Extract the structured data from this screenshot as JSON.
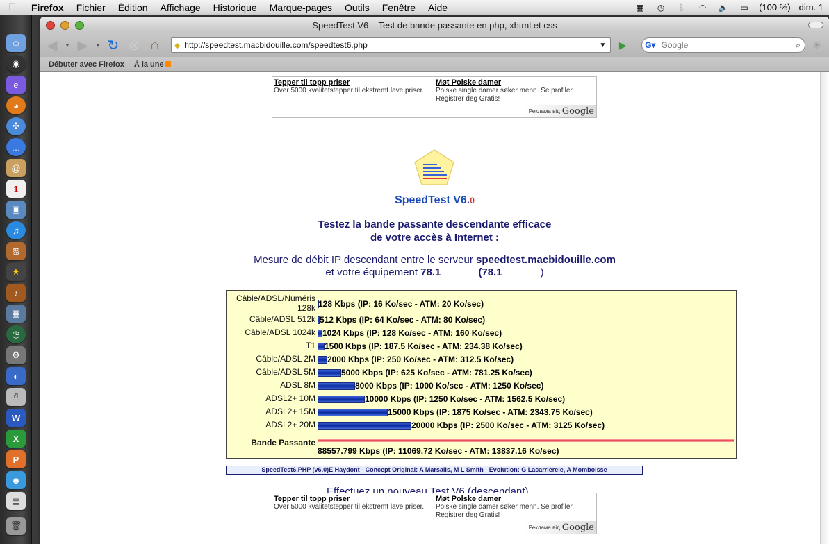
{
  "menubar": {
    "app_name": "Firefox",
    "items": [
      "Fichier",
      "Édition",
      "Affichage",
      "Historique",
      "Marque-pages",
      "Outils",
      "Fenêtre",
      "Aide"
    ],
    "battery": "(100 %)",
    "clock": "dim. 1"
  },
  "window": {
    "title": "SpeedTest V6 – Test de bande passante en php, xhtml et css",
    "url": "http://speedtest.macbidouille.com/speedtest6.php",
    "search_placeholder": "Google",
    "bookmarks": [
      "Débuter avec Firefox",
      "À la une"
    ]
  },
  "ads": {
    "col1_title": "Tepper til topp priser",
    "col1_text": "Over 5000 kvalitetstepper til ekstremt lave priser.",
    "col2_title": "Møt Polske damer",
    "col2_text": "Polske single damer søker menn. Se profiler. Registrer deg Gratis!",
    "badge_text": "Реклама від",
    "badge_logo": "Google"
  },
  "page": {
    "brand": "SpeedTest V6.",
    "brand_version": "0",
    "headline_1": "Testez la bande passante descendante efficace",
    "headline_2": "de votre accès à Internet :",
    "measure_1_pre": "Mesure de débit IP descendant entre le serveur ",
    "server": "speedtest.macbidouille.com",
    "measure_2_pre": "et votre équipement ",
    "ip_short": "78.1",
    "ip_paren_open": "(78.1",
    "ip_paren_close": ")",
    "bandwidth_label": "Bande Passante",
    "bandwidth_value": "88557.799 Kbps (IP: 11069.72 Ko/sec - ATM: 13837.16 Ko/sec)",
    "credits": "SpeedTest6.PHP (v6.0)E Haydont - Concept Original: A Marsalis, M L Smith - Evolution: G Lacarrièrele, A Momboisse",
    "new_test_link": "Effectuez un nouveau Test V6 (descendant)"
  },
  "chart_data": {
    "type": "bar",
    "categories": [
      "Câble/ADSL/Numéris 128k",
      "Câble/ADSL 512k",
      "Câble/ADSL 1024k",
      "T1",
      "Câble/ADSL 2M",
      "Câble/ADSL 5M",
      "ADSL 8M",
      "ADSL2+ 10M",
      "ADSL2+ 15M",
      "ADSL2+ 20M"
    ],
    "values": [
      128,
      512,
      1024,
      1500,
      2000,
      5000,
      8000,
      10000,
      15000,
      20000
    ],
    "labels": [
      "128 Kbps (IP: 16 Ko/sec - ATM: 20 Ko/sec)",
      "512 Kbps (IP: 64 Ko/sec - ATM: 80 Ko/sec)",
      "1024 Kbps (IP: 128 Ko/sec - ATM: 160 Ko/sec)",
      "1500 Kbps (IP: 187.5 Ko/sec - ATM: 234.38 Ko/sec)",
      "2000 Kbps (IP: 250 Ko/sec - ATM: 312.5 Ko/sec)",
      "5000 Kbps (IP: 625 Ko/sec - ATM: 781.25 Ko/sec)",
      "8000 Kbps (IP: 1000 Ko/sec - ATM: 1250 Ko/sec)",
      "10000 Kbps (IP: 1250 Ko/sec - ATM: 1562.5 Ko/sec)",
      "15000 Kbps (IP: 1875 Ko/sec - ATM: 2343.75 Ko/sec)",
      "20000 Kbps (IP: 2500 Ko/sec - ATM: 3125 Ko/sec)"
    ],
    "unit": "Kbps",
    "measured": 88557.799,
    "bar_colors": {
      "bar": "#1a3cc0",
      "measured": "#e03040"
    }
  }
}
